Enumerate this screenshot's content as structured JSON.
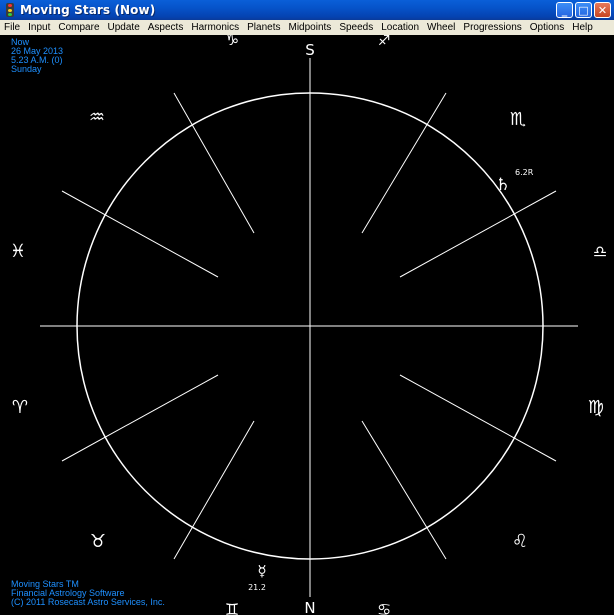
{
  "window": {
    "title": "Moving Stars (Now)",
    "buttons": {
      "minimize": "_",
      "maximize": "□",
      "close": "✕"
    }
  },
  "menu": [
    "File",
    "Input",
    "Compare",
    "Update",
    "Aspects",
    "Harmonics",
    "Planets",
    "Midpoints",
    "Speeds",
    "Location",
    "Wheel",
    "Progressions",
    "Options",
    "Help"
  ],
  "chart_info": {
    "name": "Now",
    "date": "26 May 2013",
    "time": "5.23 A.M. (0)",
    "weekday": "Sunday"
  },
  "footer": {
    "line1": "Moving Stars TM",
    "line2": "Financial Astrology Software",
    "line3": "(C) 2011 Rosecast Astro Services, Inc."
  },
  "wheel": {
    "south_label": "S",
    "north_label": "N",
    "signs": [
      {
        "name": "sagittarius-sign",
        "glyph": "♑"
      },
      {
        "name": "sagittarius-sign-top",
        "glyph": "♐"
      },
      {
        "name": "scorpio-sign",
        "glyph": "♏"
      },
      {
        "name": "libra-sign",
        "glyph": "♎"
      },
      {
        "name": "virgo-sign",
        "glyph": "♍"
      },
      {
        "name": "leo-sign",
        "glyph": "♌"
      },
      {
        "name": "cancer-sign",
        "glyph": "♋"
      },
      {
        "name": "gemini-sign",
        "glyph": "♊"
      },
      {
        "name": "taurus-sign",
        "glyph": "♉"
      },
      {
        "name": "aries-sign",
        "glyph": "♈"
      },
      {
        "name": "pisces-sign",
        "glyph": "♓"
      },
      {
        "name": "aquarius-sign",
        "glyph": "♒"
      }
    ],
    "planets": [
      {
        "name": "saturn",
        "glyph": "♄",
        "label": "6.2R"
      },
      {
        "name": "mercury",
        "glyph": "☿",
        "label": "21.2"
      }
    ]
  },
  "colors": {
    "background": "#000000",
    "lines": "#ffffff",
    "info_text": "#1e90ff"
  }
}
